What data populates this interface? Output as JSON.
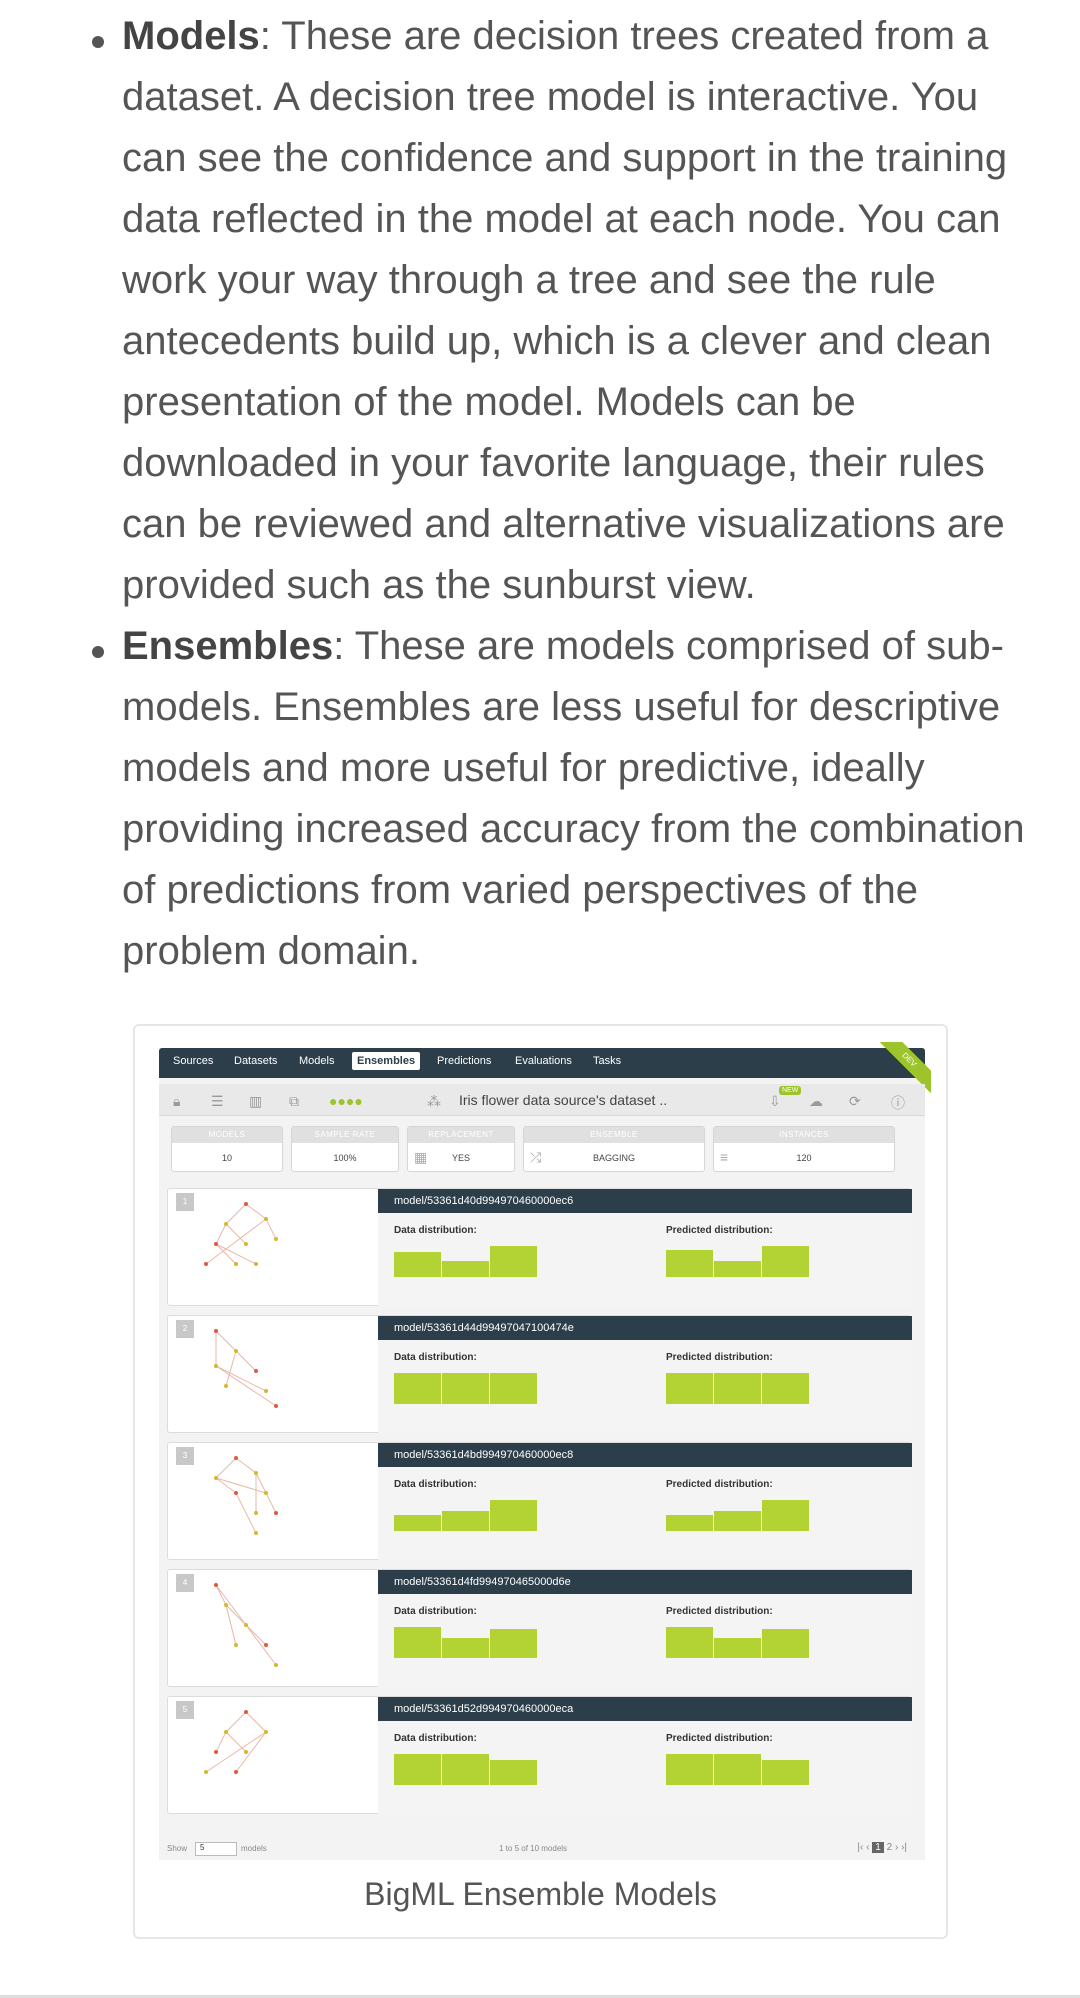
{
  "bullets": [
    {
      "term": "Models",
      "text": ": These are decision trees created from a dataset. A decision tree model is interactive. You can see the confidence and support in the training data reflected in the model at each node. You can work your way through a tree and see the rule antecedents build up, which is a clever and clean presentation of the model. Models can be downloaded in your favorite language, their rules can be reviewed and alternative visualizations are provided such as the sunburst view."
    },
    {
      "term": "Ensembles",
      "text": ": These are models comprised of sub-models. Ensembles are less useful for descriptive models and more useful for predictive, ideally providing increased accuracy from the combination of predictions from varied perspectives of the problem domain."
    }
  ],
  "figure": {
    "caption": "BigML Ensemble Models",
    "nav": [
      "Sources",
      "Datasets",
      "Models",
      "Ensembles",
      "Predictions",
      "Evaluations",
      "Tasks"
    ],
    "active_tab": "Ensembles",
    "dev_label": "DEV",
    "dataset_title": "Iris flower data source's dataset ..",
    "new_badge": "NEW",
    "stats": [
      {
        "label": "MODELS",
        "value": "10"
      },
      {
        "label": "SAMPLE RATE",
        "value": "100%"
      },
      {
        "label": "REPLACEMENT",
        "value": "YES"
      },
      {
        "label": "ENSEMBLE",
        "value": "BAGGING"
      },
      {
        "label": "INSTANCES",
        "value": "120"
      }
    ],
    "data_label": "Data distribution:",
    "pred_label": "Predicted distribution:",
    "models": [
      {
        "num": "1",
        "id": "model/53361d40d994970460000ec6",
        "data": [
          0.7,
          0.45,
          0.85
        ],
        "pred": [
          0.75,
          0.45,
          0.85
        ]
      },
      {
        "num": "2",
        "id": "model/53361d44d99497047100474e",
        "data": [
          0.85,
          0.85,
          0.85
        ],
        "pred": [
          0.85,
          0.85,
          0.85
        ]
      },
      {
        "num": "3",
        "id": "model/53361d4bd994970460000ec8",
        "data": [
          0.45,
          0.55,
          0.85
        ],
        "pred": [
          0.45,
          0.55,
          0.85
        ]
      },
      {
        "num": "4",
        "id": "model/53361d4fd994970465000d6e",
        "data": [
          0.85,
          0.55,
          0.8
        ],
        "pred": [
          0.85,
          0.55,
          0.8
        ]
      },
      {
        "num": "5",
        "id": "model/53361d52d994970460000eca",
        "data": [
          0.85,
          0.85,
          0.7
        ],
        "pred": [
          0.85,
          0.85,
          0.7
        ]
      }
    ],
    "footer": {
      "show": "Show",
      "show_value": "5",
      "models_label": "models",
      "range": "1 to 5 of 10 models",
      "pages": [
        "1",
        "2"
      ]
    }
  }
}
